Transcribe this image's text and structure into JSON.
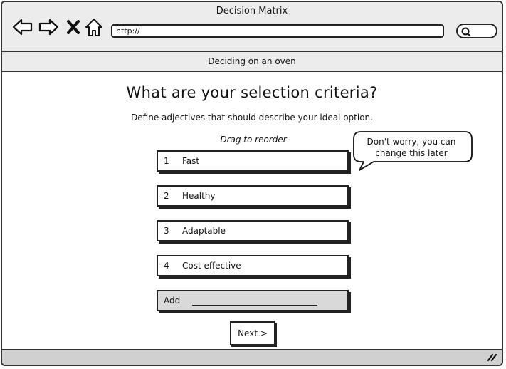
{
  "window": {
    "title": "Decision Matrix"
  },
  "toolbar": {
    "back_icon": "back-arrow-icon",
    "forward_icon": "forward-arrow-icon",
    "close_icon": "close-icon",
    "home_icon": "home-icon",
    "url_value": "http://",
    "search_icon": "search-icon"
  },
  "subbar": {
    "title": "Deciding on an oven"
  },
  "main": {
    "heading": "What are your selection criteria?",
    "subtitle": "Define adjectives that should describe your ideal option.",
    "drag_hint": "Drag to reorder",
    "criteria": [
      {
        "number": "1",
        "label": "Fast"
      },
      {
        "number": "2",
        "label": "Healthy"
      },
      {
        "number": "3",
        "label": "Adaptable"
      },
      {
        "number": "4",
        "label": "Cost effective"
      }
    ],
    "add_label": "Add",
    "add_value": "",
    "next_label": "Next >"
  },
  "tooltip": {
    "text": "Don't worry, you can change this later"
  },
  "colors": {
    "chrome": "#ececec",
    "footer": "#d0d0d0",
    "border": "#222222",
    "add_row": "#d9d9d9"
  }
}
